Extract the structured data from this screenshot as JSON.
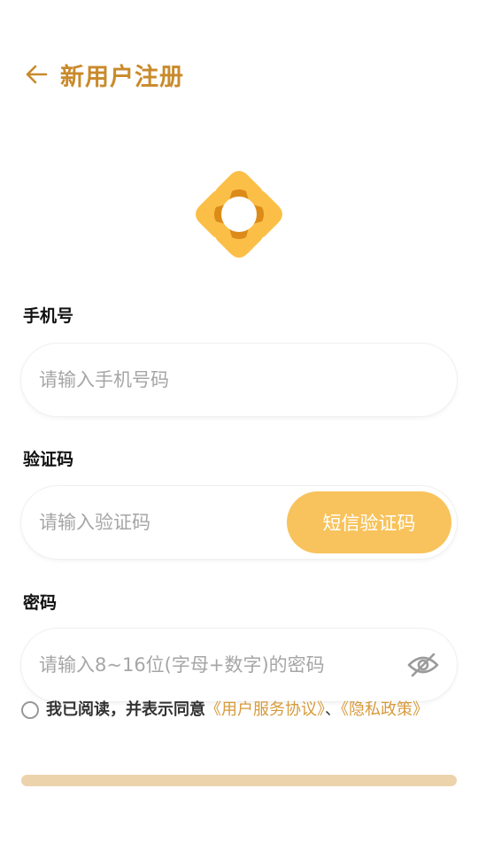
{
  "header": {
    "title": "新用户注册",
    "back_icon": "arrow-left-icon"
  },
  "logo": {
    "icon": "star-ring-logo",
    "colors": {
      "light": "#fbbf47",
      "dark": "#dc8b18"
    }
  },
  "phone": {
    "label": "手机号",
    "placeholder": "请输入手机号码",
    "value": ""
  },
  "code": {
    "label": "验证码",
    "placeholder": "请输入验证码",
    "value": "",
    "button_label": "短信验证码"
  },
  "password": {
    "label": "密码",
    "placeholder": "请输入8~16位(字母+数字)的密码",
    "value": "",
    "toggle_icon": "eye-off-icon"
  },
  "agreement": {
    "text": "我已阅读，并表示同意",
    "link_service": "《用户服务协议》",
    "separator": "、",
    "link_privacy": "《隐私政策》"
  },
  "colors": {
    "accent": "#c98a2b",
    "button": "#f8c35c",
    "link": "#d69a3a",
    "submit_disabled": "#ecd3ac"
  }
}
